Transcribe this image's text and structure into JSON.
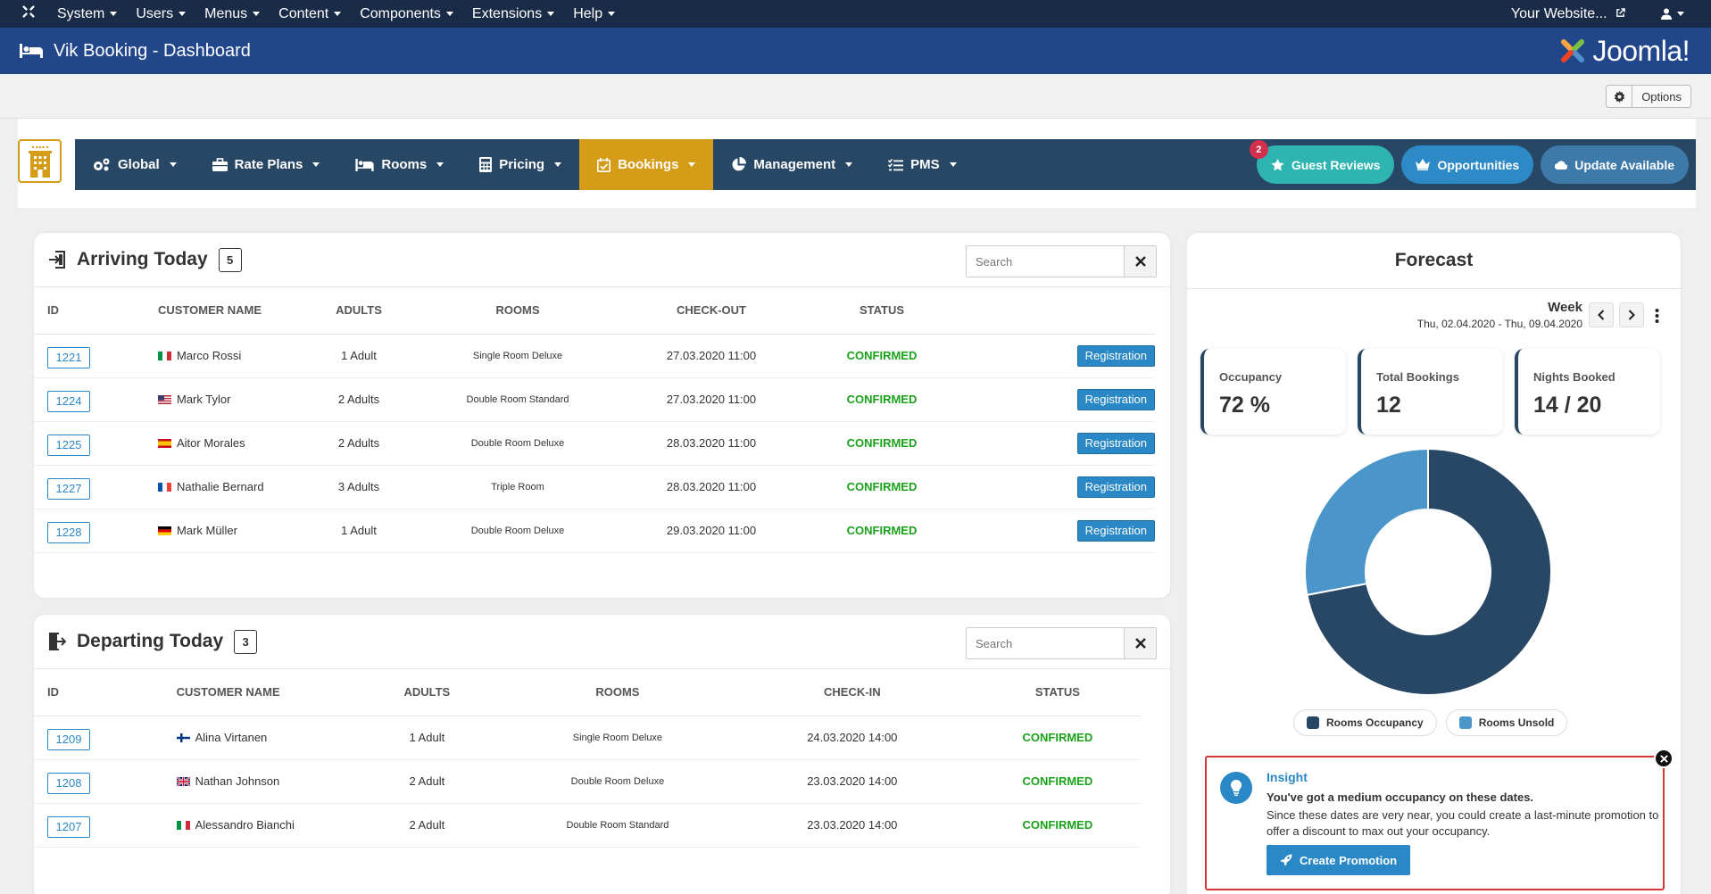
{
  "topbar": {
    "menu": [
      "System",
      "Users",
      "Menus",
      "Content",
      "Components",
      "Extensions",
      "Help"
    ],
    "site_label": "Your Website..."
  },
  "titlebar": {
    "title": "Vik Booking - Dashboard",
    "brand": "Joomla!"
  },
  "toolbar": {
    "options_label": "Options"
  },
  "nav": {
    "items": [
      {
        "label": "Global",
        "icon": "cogs-icon"
      },
      {
        "label": "Rate Plans",
        "icon": "briefcase-icon"
      },
      {
        "label": "Rooms",
        "icon": "bed-icon"
      },
      {
        "label": "Pricing",
        "icon": "calculator-icon"
      },
      {
        "label": "Bookings",
        "icon": "calendar-check-icon",
        "active": true
      },
      {
        "label": "Management",
        "icon": "pie-chart-icon"
      },
      {
        "label": "PMS",
        "icon": "list-check-icon"
      }
    ],
    "reviews_label": "Guest Reviews",
    "reviews_badge": "2",
    "opportunities_label": "Opportunities",
    "update_label": "Update Available"
  },
  "arriving": {
    "title": "Arriving Today",
    "count": "5",
    "search_placeholder": "Search",
    "headers": [
      "ID",
      "CUSTOMER NAME",
      "ADULTS",
      "ROOMS",
      "CHECK-OUT",
      "STATUS"
    ],
    "rows": [
      {
        "id": "1221",
        "flag": "it",
        "name": "Marco Rossi",
        "adults": "1 Adult",
        "room": "Single Room Deluxe",
        "date": "27.03.2020 11:00",
        "status": "CONFIRMED",
        "action": "Registration"
      },
      {
        "id": "1224",
        "flag": "us",
        "name": "Mark Tylor",
        "adults": "2 Adults",
        "room": "Double Room Standard",
        "date": "27.03.2020 11:00",
        "status": "CONFIRMED",
        "action": "Registration"
      },
      {
        "id": "1225",
        "flag": "es",
        "name": "Aitor Morales",
        "adults": "2 Adults",
        "room": "Double Room Deluxe",
        "date": "28.03.2020 11:00",
        "status": "CONFIRMED",
        "action": "Registration"
      },
      {
        "id": "1227",
        "flag": "fr",
        "name": "Nathalie Bernard",
        "adults": "3 Adults",
        "room": "Triple Room",
        "date": "28.03.2020 11:00",
        "status": "CONFIRMED",
        "action": "Registration"
      },
      {
        "id": "1228",
        "flag": "de",
        "name": "Mark Müller",
        "adults": "1 Adult",
        "room": "Double Room Deluxe",
        "date": "29.03.2020 11:00",
        "status": "CONFIRMED",
        "action": "Registration"
      }
    ]
  },
  "departing": {
    "title": "Departing Today",
    "count": "3",
    "search_placeholder": "Search",
    "headers": [
      "ID",
      "CUSTOMER NAME",
      "ADULTS",
      "ROOMS",
      "CHECK-IN",
      "STATUS"
    ],
    "rows": [
      {
        "id": "1209",
        "flag": "fi",
        "name": "Alina Virtanen",
        "adults": "1 Adult",
        "room": "Single Room Deluxe",
        "date": "24.03.2020 14:00",
        "status": "CONFIRMED"
      },
      {
        "id": "1208",
        "flag": "gb",
        "name": "Nathan Johnson",
        "adults": "2 Adult",
        "room": "Double Room Deluxe",
        "date": "23.03.2020 14:00",
        "status": "CONFIRMED"
      },
      {
        "id": "1207",
        "flag": "it",
        "name": "Alessandro Bianchi",
        "adults": "2 Adult",
        "room": "Double Room Standard",
        "date": "23.03.2020 14:00",
        "status": "CONFIRMED"
      }
    ]
  },
  "forecast": {
    "title": "Forecast",
    "period_label": "Week",
    "range": "Thu, 02.04.2020 - Thu, 09.04.2020",
    "stats": [
      {
        "label": "Occupancy",
        "value": "72 %"
      },
      {
        "label": "Total Bookings",
        "value": "12"
      },
      {
        "label": "Nights Booked",
        "value": "14 / 20"
      }
    ],
    "legend": [
      "Rooms Occupancy",
      "Rooms Unsold"
    ]
  },
  "chart_data": {
    "type": "pie",
    "categories": [
      "Rooms Occupancy",
      "Rooms Unsold"
    ],
    "values": [
      72,
      28
    ],
    "colors": [
      "#274764",
      "#4a95c9"
    ]
  },
  "insight": {
    "title": "Insight",
    "subtitle": "You've got a medium occupancy on these dates.",
    "text": "Since these dates are very near, you could create a last-minute promotion to offer a discount to max out your occupancy.",
    "action": "Create Promotion"
  }
}
